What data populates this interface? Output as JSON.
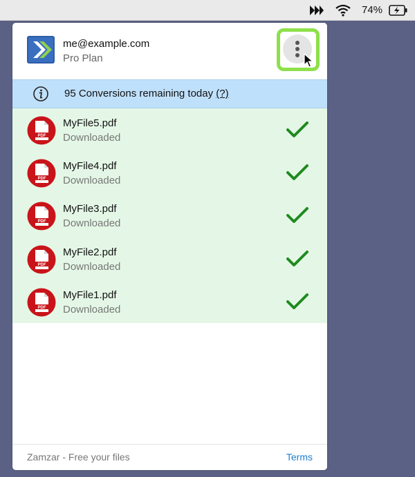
{
  "menubar": {
    "icons": [
      "fast-forward-icon",
      "wifi-icon",
      "battery-charging-icon"
    ],
    "battery_percent": "74%"
  },
  "header": {
    "email": "me@example.com",
    "plan": "Pro Plan"
  },
  "info": {
    "text": "95 Conversions remaining today",
    "help": "(?)"
  },
  "files": [
    {
      "name": "MyFile5.pdf",
      "status": "Downloaded"
    },
    {
      "name": "MyFile4.pdf",
      "status": "Downloaded"
    },
    {
      "name": "MyFile3.pdf",
      "status": "Downloaded"
    },
    {
      "name": "MyFile2.pdf",
      "status": "Downloaded"
    },
    {
      "name": "MyFile1.pdf",
      "status": "Downloaded"
    }
  ],
  "pdf_badge": "PDF",
  "footer": {
    "tagline": "Zamzar - Free your files",
    "terms": "Terms"
  },
  "colors": {
    "accent_blue": "#1f7fd0",
    "highlight_green": "#8de04a",
    "check_green": "#1f8a1f",
    "info_bg": "#bfe0fb",
    "list_bg": "#e4f7e6"
  }
}
